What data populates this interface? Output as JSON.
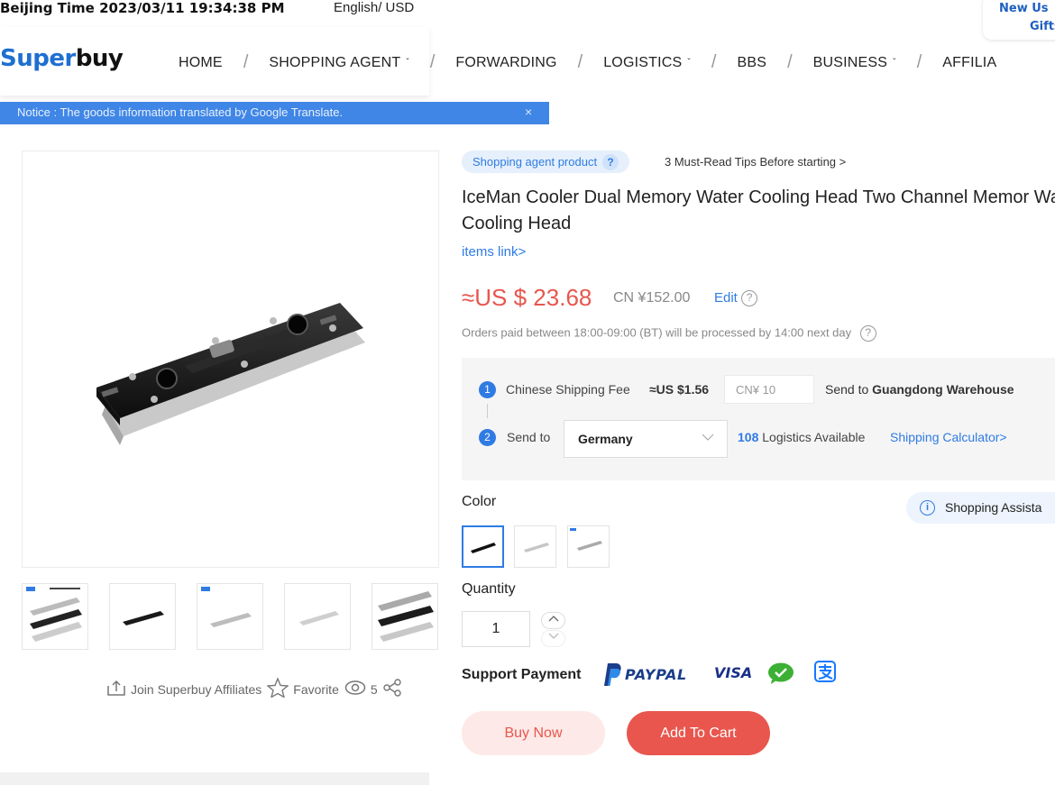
{
  "topbar": {
    "beijing_time": "Beijing Time 2023/03/11 19:34:38 PM",
    "lang_currency": "English/ USD",
    "new_user_line1": "New Us",
    "new_user_line2": "Gifts"
  },
  "logo": {
    "part1": "Super",
    "part2": "buy"
  },
  "nav": {
    "items": [
      {
        "label": "HOME"
      },
      {
        "label": "SHOPPING AGENT"
      },
      {
        "label": "FORWARDING"
      },
      {
        "label": "LOGISTICS"
      },
      {
        "label": "BBS"
      },
      {
        "label": "BUSINESS"
      },
      {
        "label": "AFFILIA"
      }
    ],
    "separator": "/",
    "chevron": "ˇ"
  },
  "notice": {
    "text": "Notice : The goods information translated by Google Translate.",
    "close": "×"
  },
  "actions": {
    "affiliates": "Join Superbuy Affiliates",
    "favorite": "Favorite",
    "views": "5"
  },
  "product": {
    "tag": "Shopping agent product",
    "tag_help": "?",
    "tips": "3 Must-Read Tips Before starting >",
    "title": "IceMan Cooler Dual Memory Water Cooling Head Two Channel Memor Water Cooling Head",
    "items_link": "items link>",
    "price_usd": "≈US $ 23.68",
    "price_cny": "CN ¥152.00",
    "edit": "Edit",
    "help": "?",
    "orders_note": "Orders paid between 18:00-09:00 (BT) will be processed by 14:00 next day"
  },
  "shipping": {
    "step1": "1",
    "step2": "2",
    "fee_label": "Chinese Shipping Fee",
    "fee_usd": "≈US $1.56",
    "cn_input_placeholder": "CN¥ 10",
    "send_to_prefix": "Send to",
    "warehouse": "Guangdong Warehouse",
    "send_to_label": "Send to",
    "country": "Germany",
    "logistics_count": "108",
    "logistics_text": "Logistics Available",
    "calculator": "Shipping Calculator>"
  },
  "color": {
    "label": "Color",
    "assistant": "Shopping Assista"
  },
  "quantity": {
    "label": "Quantity",
    "value": "1"
  },
  "payment": {
    "label": "Support Payment",
    "paypal": "PAYPAL",
    "visa": "VISA"
  },
  "buttons": {
    "buy_now": "Buy Now",
    "add_to_cart": "Add To Cart"
  }
}
